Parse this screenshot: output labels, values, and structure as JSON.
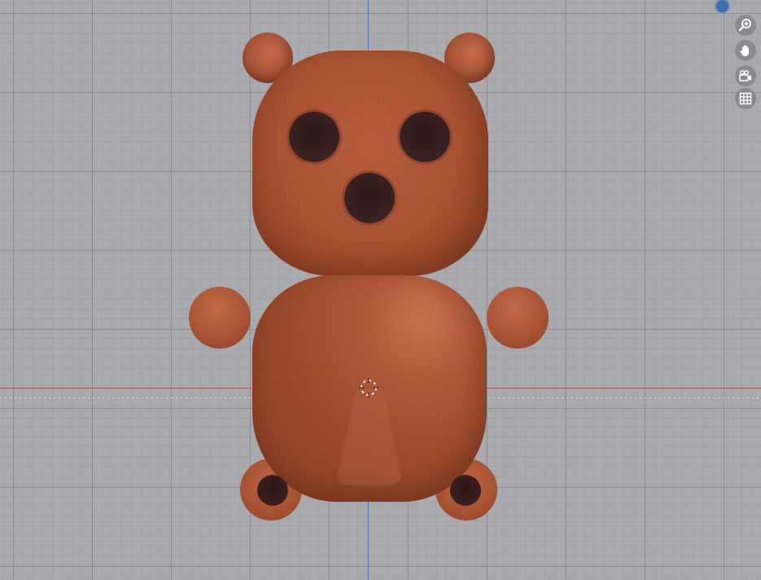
{
  "viewport": {
    "background_color": "#a9aaad",
    "axis_x_color": "#b3585b",
    "axis_y_color": "#5277b8"
  },
  "model": {
    "name_visible": false,
    "base_color": "#a6512f",
    "eye_color": "#372020"
  },
  "nav_gizmo": {
    "buttons": [
      {
        "icon": "zoom-icon"
      },
      {
        "icon": "hand-pan-icon"
      },
      {
        "icon": "camera-icon"
      },
      {
        "icon": "grid-perspective-icon"
      }
    ],
    "orientation_dot_color": "#3f6db8"
  }
}
